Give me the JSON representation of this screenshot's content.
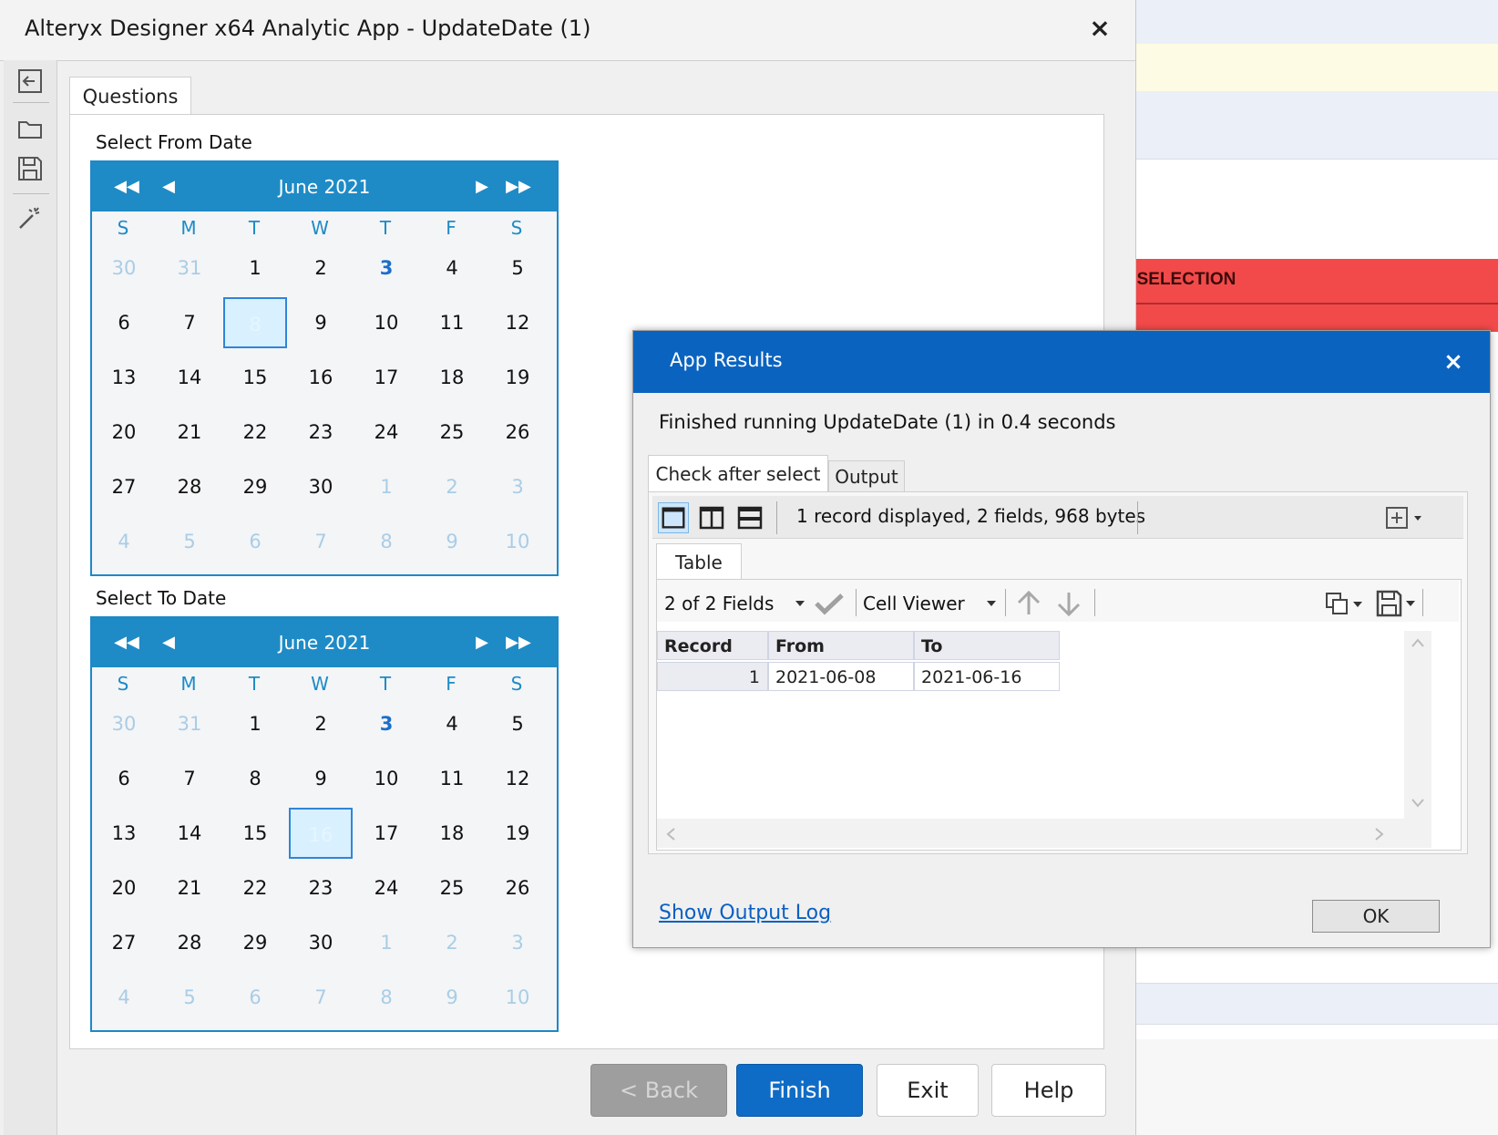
{
  "window": {
    "title": "Alteryx Designer x64 Analytic App - UpdateDate (1)",
    "close_label": "×"
  },
  "background": {
    "selection_label": ": SELECTION",
    "red_color": "#f24a4a"
  },
  "tabs": {
    "questions": "Questions"
  },
  "from_date": {
    "label": "Select From Date",
    "month": "June 2021",
    "dow": [
      "S",
      "M",
      "T",
      "W",
      "T",
      "F",
      "S"
    ],
    "selected": "8"
  },
  "to_date": {
    "label": "Select To Date",
    "month": "June 2021",
    "dow": [
      "S",
      "M",
      "T",
      "W",
      "T",
      "F",
      "S"
    ],
    "selected": "16"
  },
  "calendar_days": [
    "30",
    "31",
    "1",
    "2",
    "3",
    "4",
    "5",
    "6",
    "7",
    "8",
    "9",
    "10",
    "11",
    "12",
    "13",
    "14",
    "15",
    "16",
    "17",
    "18",
    "19",
    "20",
    "21",
    "22",
    "23",
    "24",
    "25",
    "26",
    "27",
    "28",
    "29",
    "30",
    "1",
    "2",
    "3",
    "4",
    "5",
    "6",
    "7",
    "8",
    "9",
    "10"
  ],
  "nav": {
    "prev_year": "◀◀",
    "prev_month": "◀",
    "next_month": "▶",
    "next_year": "▶▶"
  },
  "buttons": {
    "back": "< Back",
    "finish": "Finish",
    "exit": "Exit",
    "help": "Help"
  },
  "dialog": {
    "title": "App Results",
    "close_label": "×",
    "message": "Finished running UpdateDate (1) in 0.4 seconds",
    "tabs": [
      "Check after select",
      "Output"
    ],
    "record_info": "1 record displayed, 2 fields, 968 bytes",
    "table_tab": "Table",
    "fields_selector": "2 of 2 Fields",
    "cell_viewer": "Cell Viewer",
    "columns": [
      "Record",
      "From",
      "To"
    ],
    "rows": [
      [
        "1",
        "2021-06-08",
        "2021-06-16"
      ]
    ],
    "show_log": "Show Output Log",
    "ok": "OK",
    "accent": "#0b63c0"
  }
}
